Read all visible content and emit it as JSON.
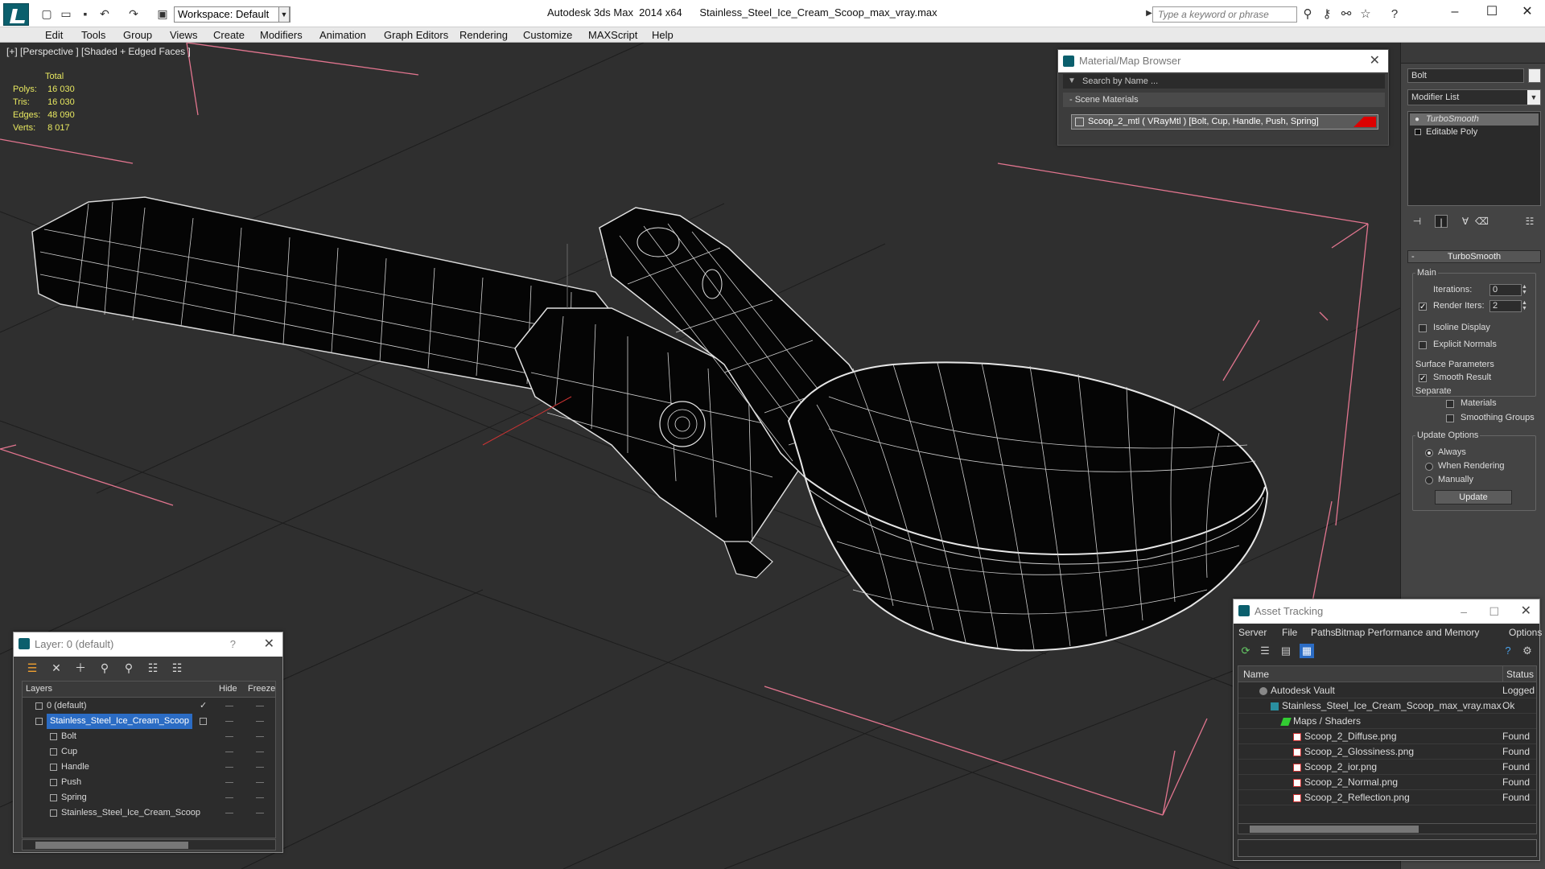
{
  "app": {
    "title": "Autodesk 3ds Max  2014 x64",
    "file": "Stainless_Steel_Ice_Cream_Scoop_max_vray.max",
    "workspace": "Workspace: Default",
    "search_placeholder": "Type a keyword or phrase"
  },
  "menu": [
    "Edit",
    "Tools",
    "Group",
    "Views",
    "Create",
    "Modifiers",
    "Animation",
    "Graph Editors",
    "Rendering",
    "Customize",
    "MAXScript",
    "Help"
  ],
  "viewport": {
    "label": "[+] [Perspective ] [Shaded + Edged Faces ]",
    "stats": {
      "header": "Total",
      "polys_label": "Polys:",
      "polys": "16 030",
      "tris_label": "Tris:",
      "tris": "16 030",
      "edges_label": "Edges:",
      "edges": "48 090",
      "verts_label": "Verts:",
      "verts": "8 017"
    }
  },
  "material_browser": {
    "title": "Material/Map Browser",
    "search_placeholder": "Search by Name ...",
    "section": "- Scene Materials",
    "material": "Scoop_2_mtl  ( VRayMtl ) [Bolt, Cup, Handle, Push, Spring]",
    "colors": {
      "swatch": "#dd0000"
    }
  },
  "command_panel": {
    "object_name": "Bolt",
    "modifier_list": "Modifier List",
    "stack": [
      "TurboSmooth",
      "Editable Poly"
    ],
    "rollout_title": "TurboSmooth",
    "main_label": "Main",
    "iterations_label": "Iterations:",
    "iterations": "0",
    "render_iters_label": "Render Iters:",
    "render_iters": "2",
    "render_iters_checked": true,
    "isoline_label": "Isoline Display",
    "explicit_normals_label": "Explicit Normals",
    "surface_params_label": "Surface Parameters",
    "smooth_result_label": "Smooth Result",
    "separate_label": "Separate",
    "materials_label": "Materials",
    "smoothing_groups_label": "Smoothing Groups",
    "update_options_label": "Update Options",
    "always_label": "Always",
    "when_rendering_label": "When Rendering",
    "manually_label": "Manually",
    "update_button": "Update"
  },
  "layers": {
    "title": "Layer: 0 (default)",
    "help": "?",
    "col_layers": "Layers",
    "col_hide": "Hide",
    "col_freeze": "Freeze",
    "rows": [
      {
        "name": "0 (default)",
        "indent": 0
      },
      {
        "name": "Stainless_Steel_Ice_Cream_Scoop",
        "indent": 0
      },
      {
        "name": "Bolt",
        "indent": 1
      },
      {
        "name": "Cup",
        "indent": 1
      },
      {
        "name": "Handle",
        "indent": 1
      },
      {
        "name": "Push",
        "indent": 1
      },
      {
        "name": "Spring",
        "indent": 1
      },
      {
        "name": "Stainless_Steel_Ice_Cream_Scoop",
        "indent": 1
      }
    ]
  },
  "asset_tracking": {
    "title": "Asset Tracking",
    "menu": [
      "Server",
      "File",
      "Paths",
      "Bitmap Performance and Memory",
      "Options"
    ],
    "col_name": "Name",
    "col_status": "Status",
    "rows": [
      {
        "name": "Autodesk Vault",
        "status": "Logged Out",
        "indent": 1
      },
      {
        "name": "Stainless_Steel_Ice_Cream_Scoop_max_vray.max",
        "status": "Ok",
        "indent": 2
      },
      {
        "name": "Maps / Shaders",
        "status": "",
        "indent": 3
      },
      {
        "name": "Scoop_2_Diffuse.png",
        "status": "Found",
        "indent": 4
      },
      {
        "name": "Scoop_2_Glossiness.png",
        "status": "Found",
        "indent": 4
      },
      {
        "name": "Scoop_2_ior.png",
        "status": "Found",
        "indent": 4
      },
      {
        "name": "Scoop_2_Normal.png",
        "status": "Found",
        "indent": 4
      },
      {
        "name": "Scoop_2_Reflection.png",
        "status": "Found",
        "indent": 4
      }
    ]
  },
  "colors": {
    "viewport_bg": "#2f2f2f",
    "selection": "#2b6cc4",
    "stats": "#e8e860",
    "bbox": "#e86a8a"
  }
}
